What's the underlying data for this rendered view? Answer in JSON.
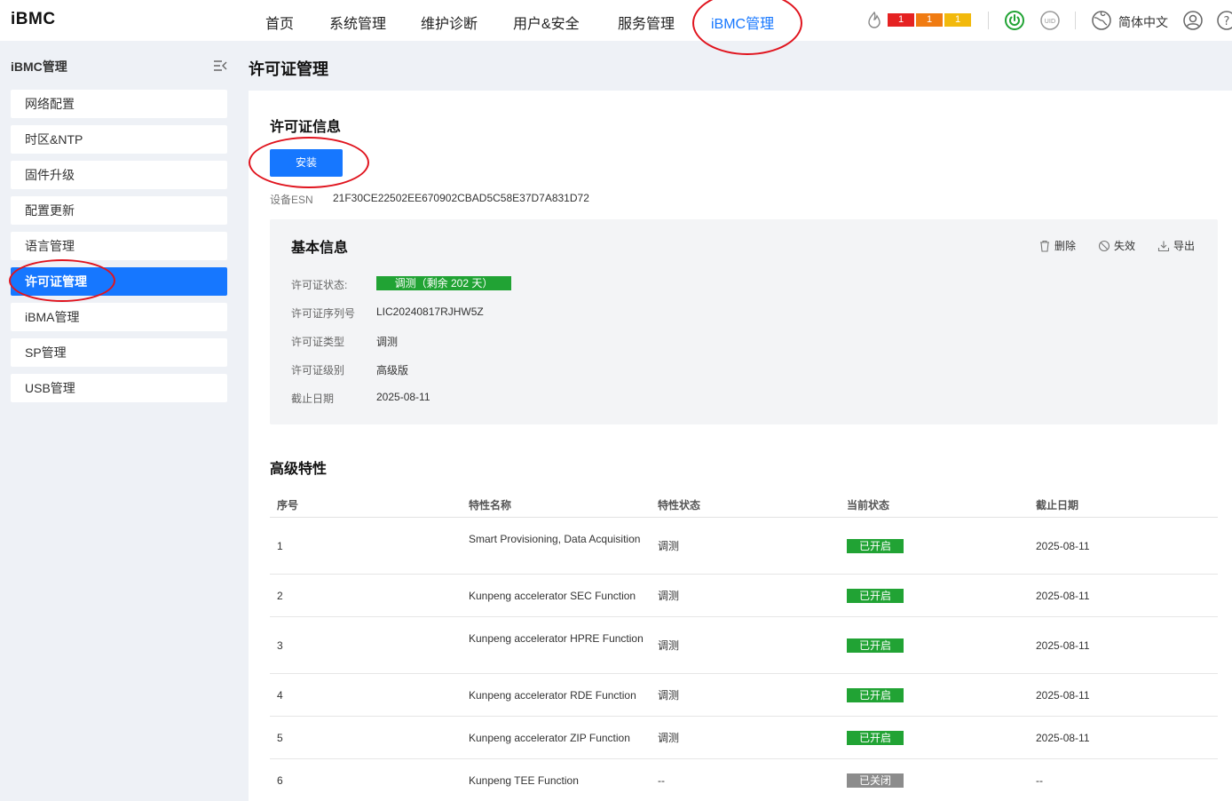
{
  "app": {
    "logo": "iBMC"
  },
  "nav": {
    "items": [
      "首页",
      "系统管理",
      "维护诊断",
      "用户&安全",
      "服务管理",
      "iBMC管理"
    ],
    "active": "iBMC管理"
  },
  "alarms": {
    "critical": "1",
    "major": "1",
    "minor": "1"
  },
  "header": {
    "language": "简体中文"
  },
  "sidebar": {
    "title": "iBMC管理",
    "items": [
      "网络配置",
      "时区&NTP",
      "固件升级",
      "配置更新",
      "语言管理",
      "许可证管理",
      "iBMA管理",
      "SP管理",
      "USB管理"
    ],
    "active": "许可证管理"
  },
  "page": {
    "title": "许可证管理"
  },
  "license_info": {
    "title": "许可证信息",
    "install_label": "安装",
    "esn_label": "设备ESN",
    "esn_value": "21F30CE22502EE670902CBAD5C58E37D7A831D72"
  },
  "basic_info": {
    "title": "基本信息",
    "actions": {
      "delete": "删除",
      "invalidate": "失效",
      "export": "导出"
    },
    "status_label": "许可证状态:",
    "status_value": "调测（剩余 202 天）",
    "serial_label": "许可证序列号",
    "serial_value": "LIC20240817RJHW5Z",
    "type_label": "许可证类型",
    "type_value": "调测",
    "level_label": "许可证级别",
    "level_value": "高级版",
    "expiry_label": "截止日期",
    "expiry_value": "2025-08-11"
  },
  "advanced": {
    "title": "高级特性",
    "columns": [
      "序号",
      "特性名称",
      "特性状态",
      "当前状态",
      "截止日期"
    ],
    "rows": [
      {
        "no": "1",
        "name": "Smart Provisioning, Data Acquisition",
        "feature_state": "调测",
        "current_state": "已开启",
        "expiry": "2025-08-11"
      },
      {
        "no": "2",
        "name": "Kunpeng accelerator SEC Function",
        "feature_state": "调测",
        "current_state": "已开启",
        "expiry": "2025-08-11"
      },
      {
        "no": "3",
        "name": "Kunpeng accelerator HPRE Function",
        "feature_state": "调测",
        "current_state": "已开启",
        "expiry": "2025-08-11"
      },
      {
        "no": "4",
        "name": "Kunpeng accelerator RDE Function",
        "feature_state": "调测",
        "current_state": "已开启",
        "expiry": "2025-08-11"
      },
      {
        "no": "5",
        "name": "Kunpeng accelerator ZIP Function",
        "feature_state": "调测",
        "current_state": "已开启",
        "expiry": "2025-08-11"
      },
      {
        "no": "6",
        "name": "Kunpeng TEE Function",
        "feature_state": "--",
        "current_state": "已关闭",
        "expiry": "--"
      }
    ]
  },
  "colors": {
    "accent": "#1677ff",
    "enabled": "#21a334",
    "disabled": "#8c8c8c",
    "critical": "#e52222",
    "major": "#f07b12",
    "minor": "#f2b90c",
    "annotation": "#e0141e"
  }
}
